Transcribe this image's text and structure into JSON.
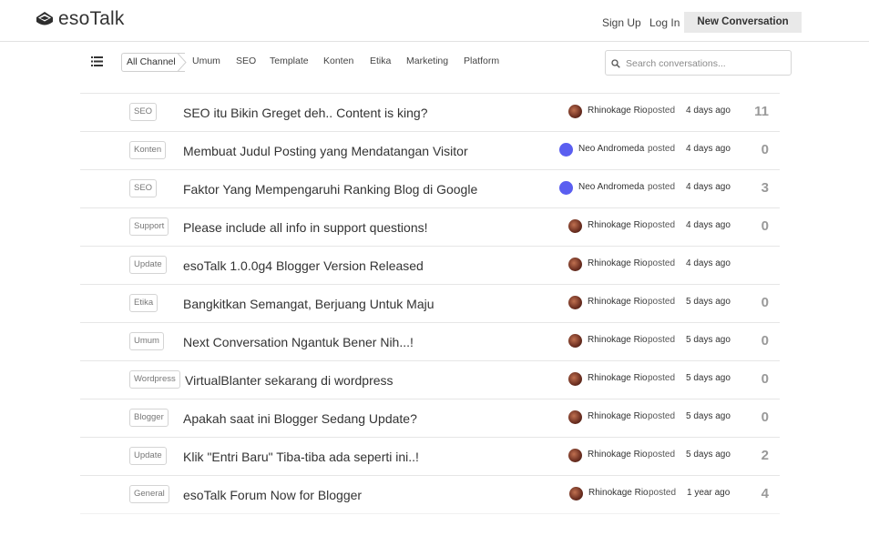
{
  "header": {
    "logo_text": "esoTalk",
    "sign_up": "Sign Up",
    "log_in": "Log In",
    "new_conversation": "New Conversation"
  },
  "channels": {
    "active": "All Channels",
    "items": [
      "Umum",
      "SEO",
      "Template",
      "Konten",
      "Etika",
      "Marketing",
      "Platform"
    ]
  },
  "search": {
    "placeholder": "Search conversations..."
  },
  "conversations": [
    {
      "tag": "SEO",
      "title": "SEO itu Bikin Greget deh.. Content is king?",
      "author": "Rhinokage Rio",
      "avatar": "photo",
      "posted": "posted",
      "time": "4 days ago",
      "replies": "11"
    },
    {
      "tag": "Konten",
      "title": "Membuat Judul Posting yang Mendatangan Visitor",
      "author": "Neo Andromeda",
      "avatar": "blue",
      "posted": "posted",
      "time": "4 days ago",
      "replies": "0"
    },
    {
      "tag": "SEO",
      "title": "Faktor Yang Mempengaruhi Ranking Blog di Google",
      "author": "Neo Andromeda",
      "avatar": "blue",
      "posted": "posted",
      "time": "4 days ago",
      "replies": "3"
    },
    {
      "tag": "Support",
      "title": "Please include all info in support questions!",
      "author": "Rhinokage Rio",
      "avatar": "photo",
      "posted": "posted",
      "time": "4 days ago",
      "replies": "0"
    },
    {
      "tag": "Update",
      "title": "esoTalk 1.0.0g4 Blogger Version Released",
      "author": "Rhinokage Rio",
      "avatar": "photo",
      "posted": "posted",
      "time": "4 days ago",
      "replies": ""
    },
    {
      "tag": "Etika",
      "title": "Bangkitkan Semangat, Berjuang Untuk Maju",
      "author": "Rhinokage Rio",
      "avatar": "photo",
      "posted": "posted",
      "time": "5 days ago",
      "replies": "0"
    },
    {
      "tag": "Umum",
      "title": "Next Conversation Ngantuk Bener Nih...!",
      "author": "Rhinokage Rio",
      "avatar": "photo",
      "posted": "posted",
      "time": "5 days ago",
      "replies": "0"
    },
    {
      "tag": "Wordpress",
      "title": "VirtualBlanter sekarang di wordpress",
      "author": "Rhinokage Rio",
      "avatar": "photo",
      "posted": "posted",
      "time": "5 days ago",
      "replies": "0"
    },
    {
      "tag": "Blogger",
      "title": "Apakah saat ini Blogger Sedang Update?",
      "author": "Rhinokage Rio",
      "avatar": "photo",
      "posted": "posted",
      "time": "5 days ago",
      "replies": "0"
    },
    {
      "tag": "Update",
      "title": "Klik \"Entri Baru\" Tiba-tiba ada seperti ini..!",
      "author": "Rhinokage Rio",
      "avatar": "photo",
      "posted": "posted",
      "time": "5 days ago",
      "replies": "2"
    },
    {
      "tag": "General",
      "title": "esoTalk Forum Now for Blogger",
      "author": "Rhinokage Rio",
      "avatar": "photo",
      "posted": "posted",
      "time": "1 year ago",
      "replies": "4"
    }
  ],
  "colors": {
    "avatar_blue": "#5a5ef0",
    "button_bg": "#e9e9e9",
    "count_gray": "#999999"
  }
}
